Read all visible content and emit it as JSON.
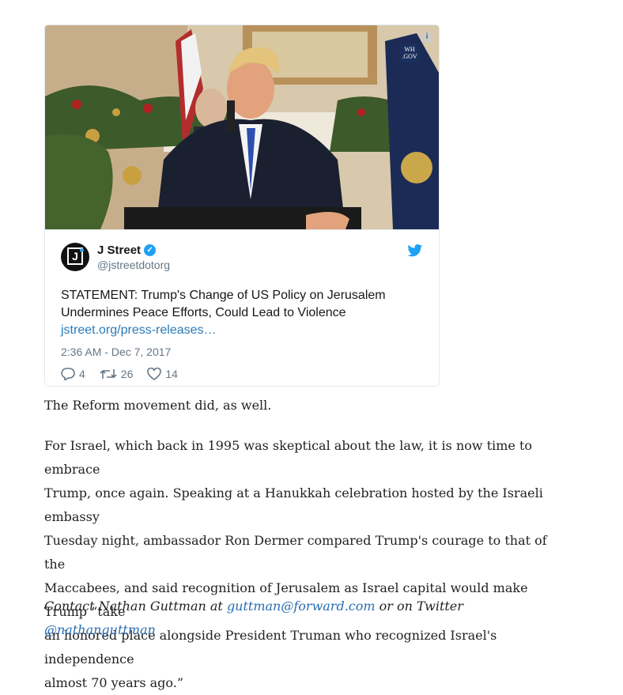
{
  "tweet": {
    "display_name": "J Street",
    "handle": "@jstreetdotorg",
    "text_line1": "STATEMENT: Trump's Change of US Policy on Jerusalem",
    "text_line2": "Undermines Peace Efforts, Could Lead to Violence",
    "link": "jstreet.org/press-releases…",
    "timestamp": "2:36 AM - Dec 7, 2017",
    "replies": "4",
    "retweets": "26",
    "likes": "14",
    "media_badge_line1": "WH",
    "media_badge_line2": ".GOV",
    "info_icon_glyph": "i",
    "avatar_letter": "J"
  },
  "article": {
    "p1": "The Reform movement did, as well.",
    "p2_lines": [
      "For Israel, which back in 1995 was skeptical about the law, it is now time to embrace",
      "Trump, once again. Speaking at a Hanukkah celebration hosted by the Israeli embassy",
      "Tuesday night, ambassador Ron Dermer compared Trump's courage to that of the",
      "Maccabees, and said recognition of Jerusalem as Israel capital would make Trump “take",
      "an honored place alongside President Truman who recognized Israel's independence",
      "almost 70 years ago.”"
    ],
    "contact_prefix": "Contact Nathan Guttman at ",
    "contact_email": "guttman@forward.com",
    "contact_middle": " or on Twitter ",
    "contact_twitter": "@nathanguttman"
  },
  "colors": {
    "link": "#2b7bb9",
    "twitter_blue": "#1da1f2",
    "muted": "#657786"
  },
  "icons": [
    "info-icon",
    "verified-icon",
    "twitter-bird-icon",
    "reply-icon",
    "retweet-icon",
    "like-icon"
  ]
}
